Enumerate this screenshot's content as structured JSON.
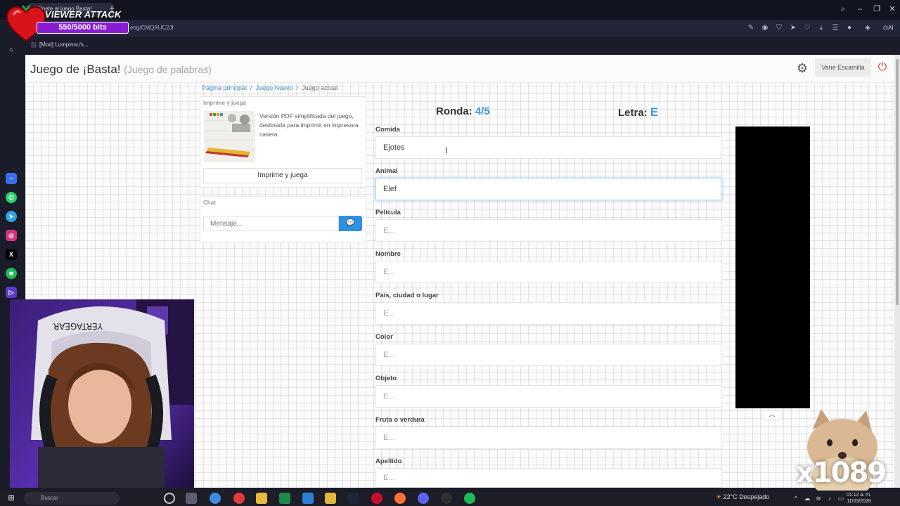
{
  "browser": {
    "tab_title": "Únete al juego Basta!",
    "url": "et/g/CMQAUC2JI",
    "bookmark": "[Mod] Lumpinou's..."
  },
  "overlay": {
    "viewer_attack": "VIEWER ATTACK",
    "bits": "550/5000 bits",
    "cat_count": "x1089"
  },
  "page": {
    "title": "Juego de ¡Basta!",
    "subtitle": "(Juego de palabras)",
    "user": "Vane Escamilla"
  },
  "breadcrumb": {
    "home": "Página principal",
    "new_game": "Juego Nuevo",
    "current": "Juego actual"
  },
  "print_panel": {
    "title": "Imprime y juega",
    "description": "Versión PDF simplificada del juego, destinada para imprimir en impresora casera.",
    "button": "Imprime y juega"
  },
  "chat": {
    "title": "Chat",
    "placeholder": "Mensaje..."
  },
  "round": {
    "label": "Ronda:",
    "value": "4/5"
  },
  "letter": {
    "label": "Letra:",
    "value": "E"
  },
  "fields": [
    {
      "label": "Comida",
      "value": "Ejotes",
      "placeholder": "E..."
    },
    {
      "label": "Animal",
      "value": "Elef",
      "placeholder": "E..."
    },
    {
      "label": "Película",
      "value": "",
      "placeholder": "E..."
    },
    {
      "label": "Nombre",
      "value": "",
      "placeholder": "E..."
    },
    {
      "label": "País, ciudad o lugar",
      "value": "",
      "placeholder": "E..."
    },
    {
      "label": "Color",
      "value": "",
      "placeholder": "E..."
    },
    {
      "label": "Objeto",
      "value": "",
      "placeholder": "E..."
    },
    {
      "label": "Fruta o verdura",
      "value": "",
      "placeholder": "E..."
    },
    {
      "label": "Apellido",
      "value": "",
      "placeholder": "E..."
    }
  ],
  "taskbar": {
    "search": "Buscar",
    "weather": "22°C  Despejado",
    "time": "01:12 a. m.",
    "date": "11/03/2026"
  },
  "aria": "AI",
  "colors": {
    "accent": "#3f97d8",
    "chat_send": "#2e90e0",
    "power": "#e04040",
    "bits_bar": "#8a1bd4"
  }
}
